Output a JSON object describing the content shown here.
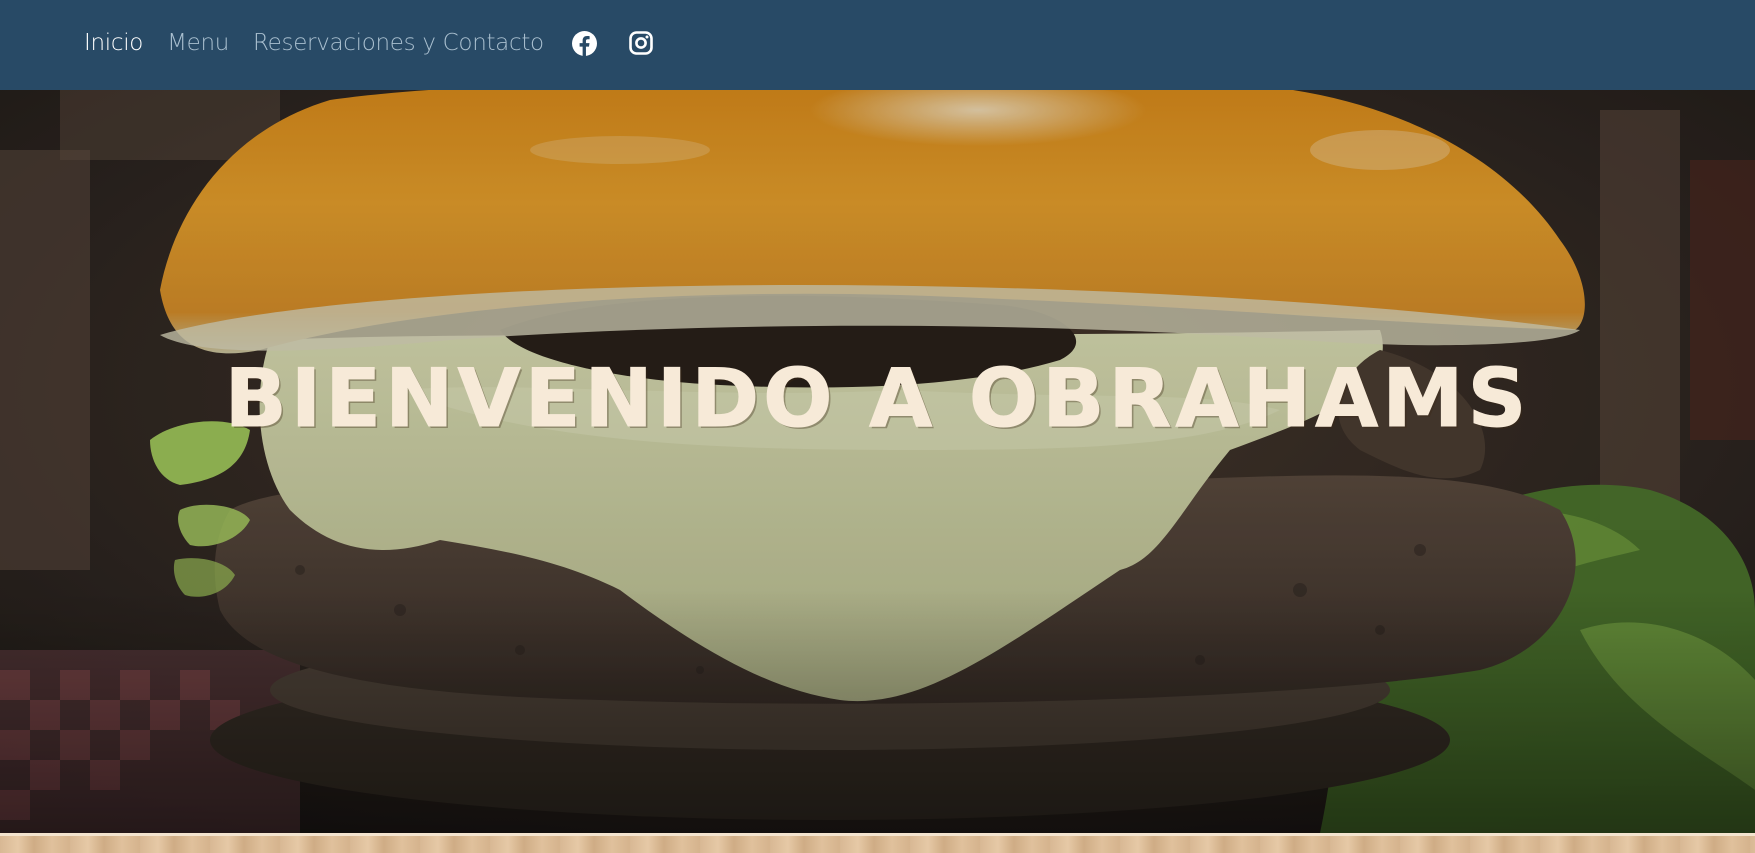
{
  "colors": {
    "navbar_bg": "#284a66",
    "nav_active": "#ffffff",
    "nav_inactive": "#a9bfcf",
    "hero_title": "#f7ead8"
  },
  "nav": {
    "items": [
      {
        "label": "Inicio",
        "active": true
      },
      {
        "label": "Menu",
        "active": false
      },
      {
        "label": "Reservaciones y Contacto",
        "active": false
      }
    ],
    "social": [
      {
        "icon": "facebook-icon"
      },
      {
        "icon": "instagram-icon"
      }
    ]
  },
  "hero": {
    "title": "BIENVENIDO A OBRAHAMS",
    "image": "burger-photo"
  }
}
